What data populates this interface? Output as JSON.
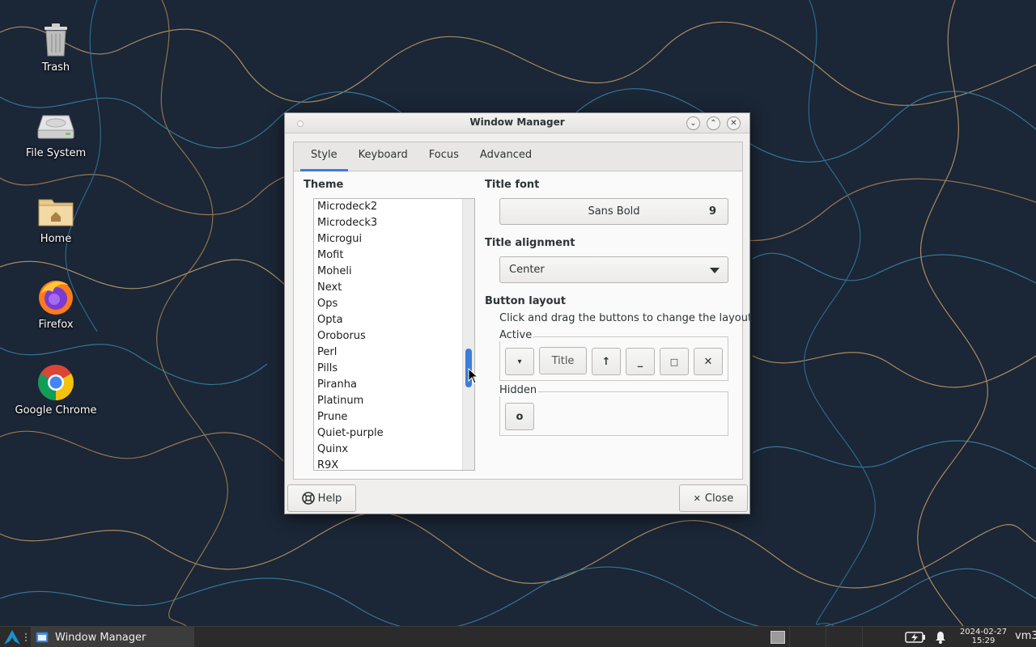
{
  "desktop": {
    "icons": [
      {
        "label": "Trash",
        "icon": "trash-icon"
      },
      {
        "label": "File System",
        "icon": "drive-icon"
      },
      {
        "label": "Home",
        "icon": "home-folder-icon"
      },
      {
        "label": "Firefox",
        "icon": "firefox-icon"
      },
      {
        "label": "Google Chrome",
        "icon": "chrome-icon"
      }
    ]
  },
  "window": {
    "title": "Window Manager",
    "tabs": [
      {
        "label": "Style",
        "active": true
      },
      {
        "label": "Keyboard",
        "active": false
      },
      {
        "label": "Focus",
        "active": false
      },
      {
        "label": "Advanced",
        "active": false
      }
    ],
    "theme": {
      "heading": "Theme",
      "items": [
        "Microdeck2",
        "Microdeck3",
        "Microgui",
        "Mofit",
        "Moheli",
        "Next",
        "Ops",
        "Opta",
        "Oroborus",
        "Perl",
        "Pills",
        "Piranha",
        "Platinum",
        "Prune",
        "Quiet-purple",
        "Quinx",
        "R9X"
      ]
    },
    "title_font": {
      "heading": "Title font",
      "font_name": "Sans Bold",
      "font_size": "9"
    },
    "title_alignment": {
      "heading": "Title alignment",
      "selected": "Center"
    },
    "button_layout": {
      "heading": "Button layout",
      "hint": "Click and drag the buttons to change the layout",
      "active_label": "Active",
      "active_buttons": [
        "▾",
        "Title",
        "↑",
        "_",
        "□",
        "✕"
      ],
      "hidden_label": "Hidden",
      "hidden_buttons": [
        "o"
      ]
    },
    "footer": {
      "help_label": "Help",
      "close_label": "Close"
    }
  },
  "taskbar": {
    "task_label": "Window Manager",
    "date": "2024-02-27",
    "time": "15:29",
    "user": "vm3"
  },
  "colors": {
    "accent": "#3b7dd8",
    "desktop": "#1c2838",
    "taskbar": "#2b2b2b"
  }
}
